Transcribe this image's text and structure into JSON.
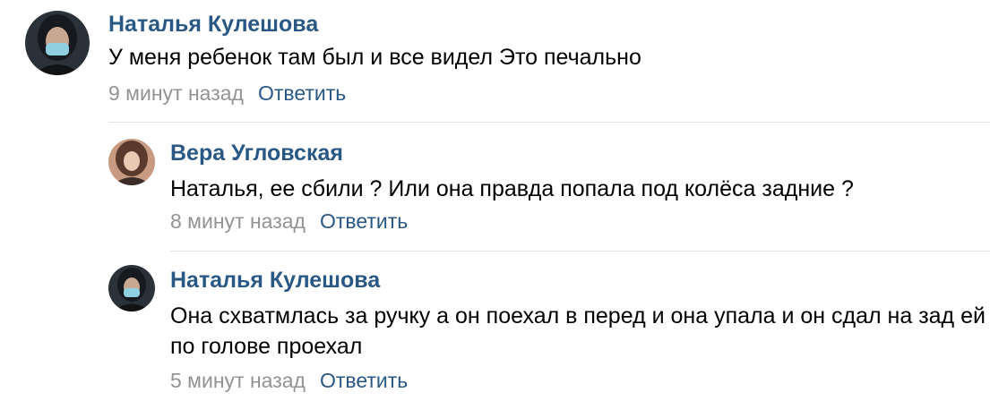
{
  "comments": [
    {
      "author": "Наталья Кулешова",
      "text": "У меня ребенок там был и все видел Это печально",
      "time": "9 минут назад",
      "reply_label": "Ответить"
    },
    {
      "author": "Вера Угловская",
      "text": "Наталья, ее сбили ? Или она правда попала под колёса задние ?",
      "time": "8 минут назад",
      "reply_label": "Ответить"
    },
    {
      "author": "Наталья Кулешова",
      "text": "Она схватмлась за ручку а он поехал в перед и она упала и он сдал на зад ей по голове проехал",
      "time": "5 минут назад",
      "reply_label": "Ответить"
    }
  ],
  "colors": {
    "author": "#2a5885",
    "reply": "#2a5885",
    "time": "#939393",
    "divider": "#e1e3e6"
  }
}
